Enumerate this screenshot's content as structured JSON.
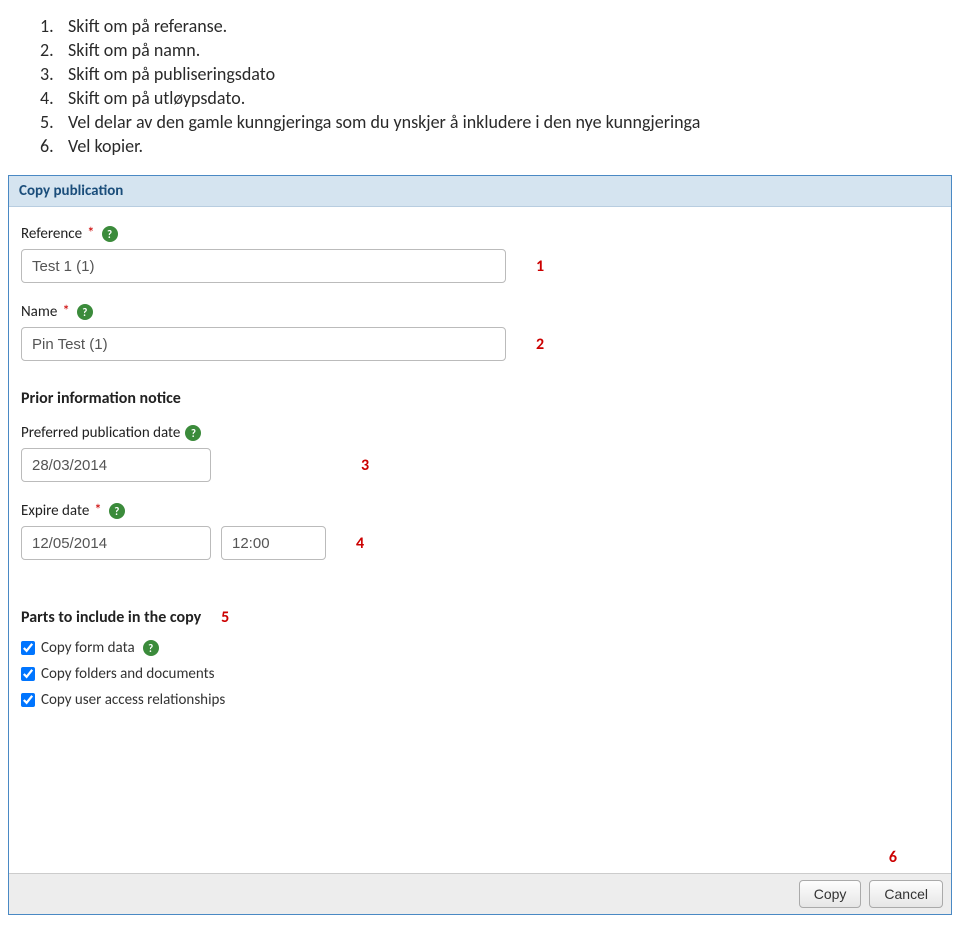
{
  "instructions": [
    {
      "num": "1.",
      "text": "Skift om på referanse."
    },
    {
      "num": "2.",
      "text": "Skift om på namn."
    },
    {
      "num": "3.",
      "text": "Skift om på publiseringsdato"
    },
    {
      "num": "4.",
      "text": "Skift om på utløypsdato."
    },
    {
      "num": "5.",
      "text": "Vel delar av den gamle kunngjeringa som du ynskjer å inkludere i den nye kunngjeringa"
    },
    {
      "num": "6.",
      "text": "Vel  kopier."
    }
  ],
  "panel": {
    "title": "Copy publication",
    "reference": {
      "label": "Reference",
      "required": "*",
      "value": "Test 1 (1)",
      "annotation": "1"
    },
    "name": {
      "label": "Name",
      "required": "*",
      "value": "Pin Test (1)",
      "annotation": "2"
    },
    "prior_notice": {
      "title": "Prior information notice",
      "pub_date": {
        "label": "Preferred publication date",
        "value": "28/03/2014",
        "annotation": "3"
      },
      "expire": {
        "label": "Expire date",
        "required": "*",
        "date": "12/05/2014",
        "time": "12:00",
        "annotation": "4"
      }
    },
    "parts": {
      "title": "Parts to include in the copy",
      "annotation": "5",
      "items": [
        {
          "label": "Copy form data",
          "checked": true,
          "help": true
        },
        {
          "label": "Copy folders and documents",
          "checked": true,
          "help": false
        },
        {
          "label": "Copy user access relationships",
          "checked": true,
          "help": false
        }
      ]
    },
    "footer": {
      "annotation": "6",
      "copy": "Copy",
      "cancel": "Cancel"
    },
    "help_glyph": "?"
  }
}
